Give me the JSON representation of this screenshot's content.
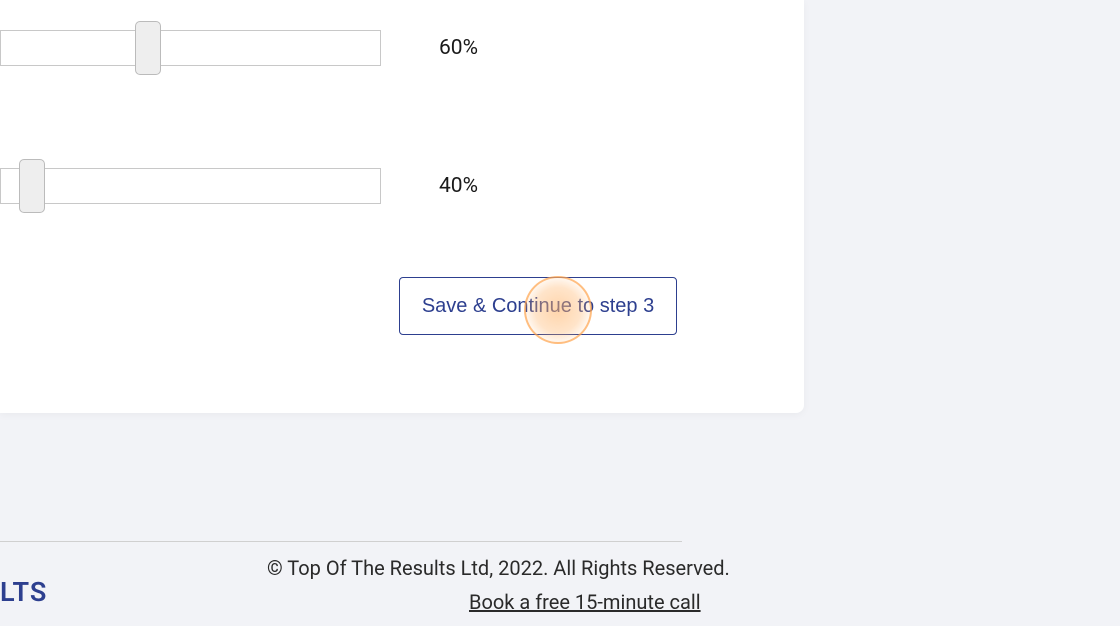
{
  "sliders": {
    "slider1": {
      "value_label": "60%"
    },
    "slider2": {
      "value_label": "40%"
    }
  },
  "actions": {
    "save_continue_label": "Save & Continue to step 3"
  },
  "footer": {
    "copyright": "© Top Of The Results Ltd, 2022. All Rights Reserved.",
    "cta_label": "Book a free 15-minute call",
    "logo_fragment": "LTS"
  }
}
